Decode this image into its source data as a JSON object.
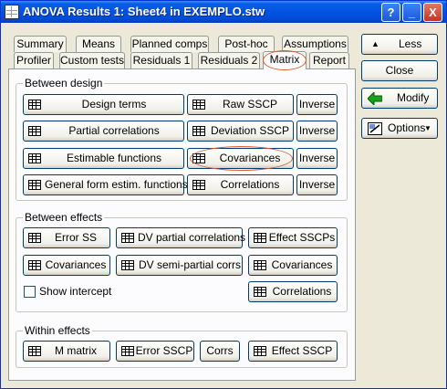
{
  "window": {
    "title": "ANOVA Results 1: Sheet4 in EXEMPLO.stw",
    "help_btn": "?",
    "minimize_btn": "_",
    "close_btn": "X"
  },
  "tabs_row1": [
    "Summary",
    "Means",
    "Planned comps",
    "Post-hoc",
    "Assumptions"
  ],
  "tabs_row2": [
    "Profiler",
    "Custom tests",
    "Residuals 1",
    "Residuals 2",
    "Matrix",
    "Report"
  ],
  "active_tab": "Matrix",
  "between_design": {
    "label": "Between design",
    "design_terms": "Design terms",
    "partial_correlations": "Partial correlations",
    "estimable_functions": "Estimable functions",
    "general_form": "General form estim. functions",
    "raw_sscp": "Raw SSCP",
    "deviation_sscp": "Deviation SSCP",
    "covariances": "Covariances",
    "correlations": "Correlations",
    "inverse": "Inverse"
  },
  "between_effects": {
    "label": "Between effects",
    "error_ss": "Error SS",
    "dv_partial": "DV partial correlations",
    "effect_sscps": "Effect SSCPs",
    "covariances1": "Covariances",
    "dv_semipartial": "DV semi-partial corrs",
    "covariances2": "Covariances",
    "show_intercept": "Show intercept",
    "correlations": "Correlations"
  },
  "within_effects": {
    "label": "Within effects",
    "m_matrix": "M matrix",
    "error_sscp": "Error SSCP",
    "corrs": "Corrs",
    "effect_sscp": "Effect SSCP"
  },
  "side": {
    "less": "Less",
    "close": "Close",
    "modify": "Modify",
    "options": "Options"
  },
  "colors": {
    "titlebar": "#0054e3",
    "highlight": "#e05a2a",
    "modify_arrow": "#1aa31a"
  }
}
